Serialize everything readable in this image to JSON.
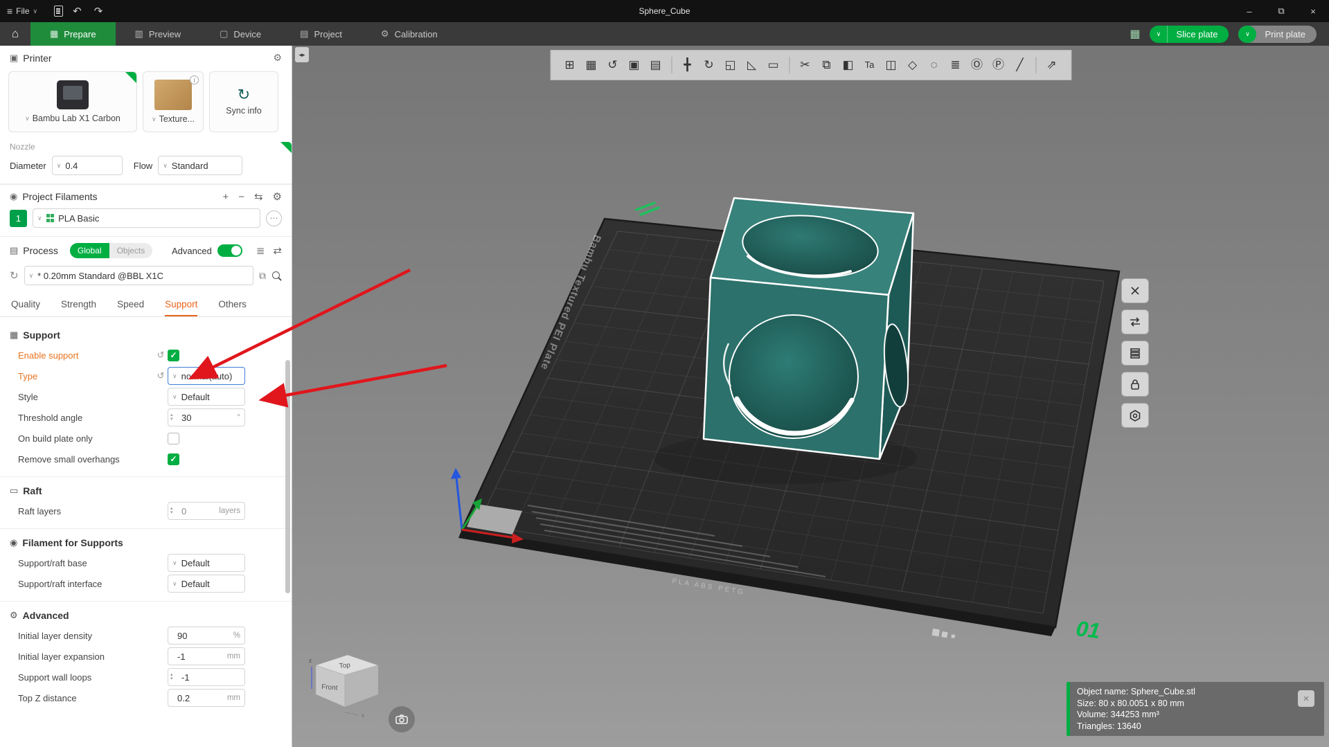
{
  "titlebar": {
    "menu_label": "File",
    "title": "Sphere_Cube"
  },
  "nav": {
    "tabs": [
      {
        "label": "Prepare",
        "glyph": "▦"
      },
      {
        "label": "Preview",
        "glyph": "▥"
      },
      {
        "label": "Device",
        "glyph": "▢"
      },
      {
        "label": "Project",
        "glyph": "▤"
      },
      {
        "label": "Calibration",
        "glyph": "⚙"
      }
    ],
    "active_tab": "Prepare",
    "slice_label": "Slice plate",
    "print_label": "Print plate"
  },
  "colors": {
    "accent_green": "#00AE42",
    "modified_orange": "#E8731F",
    "arrow_red": "#E0161C",
    "active_tab_green": "#1F8C3C"
  },
  "icons": {
    "menu": "≡",
    "chevron": "∨",
    "home": "⌂",
    "undo": "↶",
    "redo": "↷",
    "minimize": "–",
    "maximize": "⧉",
    "close": "×",
    "gear": "⚙",
    "printer": "▣",
    "filament": "◉",
    "process": "▤",
    "plus": "+",
    "minus": "−",
    "sync_filament": "⇆",
    "edit": "⋯",
    "info": "i",
    "refresh": "↻",
    "copy": "⧉",
    "reset": "↺",
    "list": "≣",
    "compare": "⇄",
    "collapse": "◂▸",
    "sync_big": "↻",
    "plate_badge": "▦",
    "support_group": "▦",
    "raft_group": "▭",
    "filament_group": "◉",
    "advanced_group": "⚙"
  },
  "printer": {
    "section_title": "Printer",
    "printer_name": "Bambu Lab X1 Carbon",
    "plate_name": "Texture...",
    "sync_label": "Sync info",
    "nozzle_label": "Nozzle",
    "diameter_label": "Diameter",
    "diameter_value": "0.4",
    "flow_label": "Flow",
    "flow_value": "Standard"
  },
  "filaments": {
    "section_title": "Project Filaments",
    "slot": "1",
    "filament_name": "PLA Basic"
  },
  "process": {
    "section_title": "Process",
    "scope_global": "Global",
    "scope_objects": "Objects",
    "advanced_label": "Advanced",
    "preset": "* 0.20mm Standard @BBL X1C",
    "tabs": [
      {
        "label": "Quality"
      },
      {
        "label": "Strength"
      },
      {
        "label": "Speed"
      },
      {
        "label": "Support"
      },
      {
        "label": "Others"
      }
    ],
    "active_tab": "Support"
  },
  "settings": {
    "groups": [
      {
        "title": "Support",
        "rows": [
          {
            "label": "Enable support",
            "control": "checkbox",
            "checked": true,
            "modified": true
          },
          {
            "label": "Type",
            "control": "select",
            "value": "normal(auto)",
            "modified": true
          },
          {
            "label": "Style",
            "control": "select",
            "value": "Default"
          },
          {
            "label": "Threshold angle",
            "control": "spinner",
            "value": "30",
            "unit": "°"
          },
          {
            "label": "On build plate only",
            "control": "checkbox",
            "checked": false
          },
          {
            "label": "Remove small overhangs",
            "control": "checkbox",
            "checked": true
          }
        ]
      },
      {
        "title": "Raft",
        "rows": [
          {
            "label": "Raft layers",
            "control": "spinner",
            "value": "0",
            "unit": "layers"
          }
        ]
      },
      {
        "title": "Filament for Supports",
        "rows": [
          {
            "label": "Support/raft base",
            "control": "select",
            "value": "Default"
          },
          {
            "label": "Support/raft interface",
            "control": "select",
            "value": "Default"
          }
        ]
      },
      {
        "title": "Advanced",
        "rows": [
          {
            "label": "Initial layer density",
            "control": "spinner",
            "value": "90",
            "unit": "%"
          },
          {
            "label": "Initial layer expansion",
            "control": "spinner",
            "value": "-1",
            "unit": "mm"
          },
          {
            "label": "Support wall loops",
            "control": "spinner",
            "value": "-1",
            "unit": ""
          },
          {
            "label": "Top Z distance",
            "control": "spinner",
            "value": "0.2",
            "unit": "mm"
          }
        ]
      }
    ]
  },
  "toolbar": {
    "icons": [
      {
        "name": "add-icon",
        "glyph": "⊞"
      },
      {
        "name": "add-plate-icon",
        "glyph": "▦"
      },
      {
        "name": "auto-orient-icon",
        "glyph": "↺"
      },
      {
        "name": "arrange-icon",
        "glyph": "▣"
      },
      {
        "name": "split-icon",
        "glyph": "▤"
      },
      {
        "divider": true
      },
      {
        "name": "move-icon",
        "glyph": "╋"
      },
      {
        "name": "rotate-icon",
        "glyph": "↻"
      },
      {
        "name": "scale-icon",
        "glyph": "◱"
      },
      {
        "name": "lay-on-face-icon",
        "glyph": "◺"
      },
      {
        "name": "align-icon",
        "glyph": "▭"
      },
      {
        "divider": true
      },
      {
        "name": "cut-icon",
        "glyph": "✂"
      },
      {
        "name": "clone-icon",
        "glyph": "⧉"
      },
      {
        "name": "color-paint-icon",
        "glyph": "◧"
      },
      {
        "name": "text-icon",
        "glyph": "Ta"
      },
      {
        "name": "emboss-icon",
        "glyph": "◫"
      },
      {
        "name": "mesh-boolean-icon",
        "glyph": "◇"
      },
      {
        "name": "seam-paint-icon",
        "glyph": "◌"
      },
      {
        "name": "variable-layer-height-icon",
        "glyph": "≣"
      },
      {
        "name": "timelapse-icon",
        "glyph": "Ⓞ"
      },
      {
        "name": "plate-settings-icon",
        "glyph": "Ⓟ"
      },
      {
        "name": "measure-icon",
        "glyph": "╱"
      },
      {
        "divider": true
      },
      {
        "name": "assembly-view-icon",
        "glyph": "⇗"
      }
    ]
  },
  "viewport": {
    "plate_brand": "Bambu Textured PEI Plate",
    "plate_marking": "PLA ABS PETG",
    "plate_number": "01",
    "gizmo_top": "Top",
    "gizmo_front": "Front",
    "info_panel": {
      "lines": [
        "Object name: Sphere_Cube.stl",
        "Size: 80 x 80.0051 x 80 mm",
        "Volume: 344253 mm³",
        "Triangles: 13640"
      ]
    }
  }
}
